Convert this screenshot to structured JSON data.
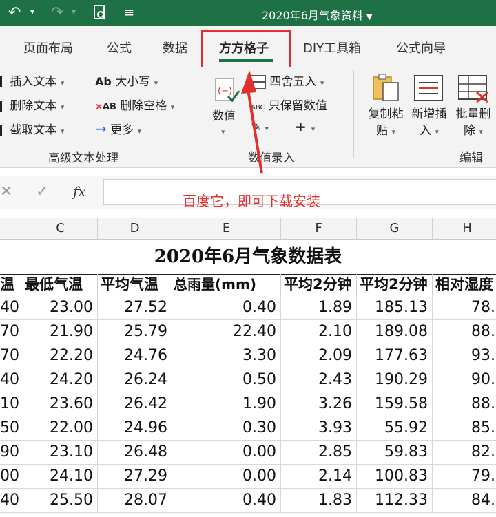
{
  "titlebar": {
    "document_title": "2020年6月气象资料",
    "bg_color": "#1e7145"
  },
  "tabs": [
    {
      "label": "页面布局",
      "active": false
    },
    {
      "label": "公式",
      "active": false
    },
    {
      "label": "数据",
      "active": false
    },
    {
      "label": "方方格子",
      "active": true
    },
    {
      "label": "DIY工具箱",
      "active": false
    },
    {
      "label": "公式向导",
      "active": false
    }
  ],
  "ribbon": {
    "text_group": {
      "insert_text": "插入文本",
      "delete_text": "删除文本",
      "extract_text": "截取文本",
      "case": "大小写",
      "case_icon_text": "Ab",
      "delete_space": "删除空格",
      "delete_space_icon_text": "AB",
      "more": "更多",
      "group_label": "高级文本处理"
    },
    "number_group": {
      "value": "数值",
      "round": "四舍五入",
      "keep_values": "只保留数值",
      "keep_values_icon_text": "ABC",
      "plus": "+",
      "group_label": "数值录入"
    },
    "edit_group": {
      "copy_paste_line1": "复制粘",
      "copy_paste_line2": "贴",
      "new_insert_line1": "新增插",
      "new_insert_line2": "入",
      "batch_delete_line1": "批量删",
      "batch_delete_line2": "除",
      "group_label": "编辑"
    }
  },
  "formula_bar": {
    "fx_label": "fx",
    "value": ""
  },
  "annotation": "百度它，即可下载安装",
  "columns": [
    "C",
    "D",
    "E",
    "F",
    "G",
    "H"
  ],
  "sheet": {
    "title": "2020年6月气象数据表",
    "headers": [
      "温（",
      "最低气温",
      "平均气温",
      "总雨量(mm)",
      "平均2分钟",
      "平均2分钟",
      "相对湿度"
    ],
    "rows": [
      [
        "40",
        "23.00",
        "27.52",
        "0.40",
        "1.89",
        "185.13",
        "78."
      ],
      [
        "70",
        "21.90",
        "25.79",
        "22.40",
        "2.10",
        "189.08",
        "88."
      ],
      [
        "70",
        "22.20",
        "24.76",
        "3.30",
        "2.09",
        "177.63",
        "93."
      ],
      [
        "40",
        "24.20",
        "26.24",
        "0.50",
        "2.43",
        "190.29",
        "90."
      ],
      [
        "10",
        "23.60",
        "26.42",
        "1.90",
        "3.26",
        "159.58",
        "88."
      ],
      [
        "50",
        "22.00",
        "24.96",
        "0.30",
        "3.93",
        "55.92",
        "85."
      ],
      [
        "90",
        "23.10",
        "26.48",
        "0.00",
        "2.85",
        "59.83",
        "82."
      ],
      [
        "00",
        "24.10",
        "27.29",
        "0.00",
        "2.14",
        "100.83",
        "79."
      ],
      [
        "40",
        "25.50",
        "28.07",
        "0.40",
        "1.83",
        "112.33",
        "84."
      ],
      [
        "",
        "",
        "",
        "",
        "",
        "",
        ""
      ]
    ]
  },
  "colors": {
    "accent_green": "#1e7145",
    "highlight_red": "#e0312f"
  }
}
